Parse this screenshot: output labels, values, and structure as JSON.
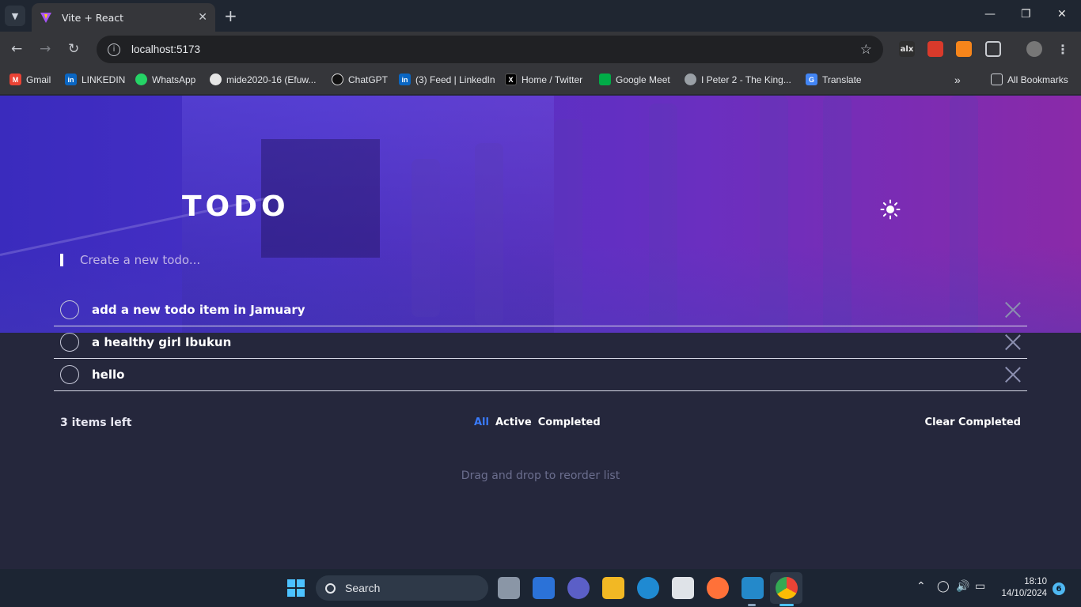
{
  "browser": {
    "tab_title": "Vite + React",
    "url": "localhost:5173",
    "bookmarks": [
      {
        "label": "Gmail",
        "icon": "gmail-icon",
        "color": "#ea4335"
      },
      {
        "label": "LINKEDIN",
        "icon": "linkedin-icon",
        "color": "#0a66c2"
      },
      {
        "label": "WhatsApp",
        "icon": "whatsapp-icon",
        "color": "#25d366"
      },
      {
        "label": "mide2020-16 (Efuw...",
        "icon": "github-icon",
        "color": "#e6e6e6"
      },
      {
        "label": "ChatGPT",
        "icon": "chatgpt-icon",
        "color": "#ffffff"
      },
      {
        "label": "(3) Feed | LinkedIn",
        "icon": "linkedin-icon",
        "color": "#0a66c2"
      },
      {
        "label": "Home / Twitter",
        "icon": "x-twitter-icon",
        "color": "#000000"
      },
      {
        "label": "Google Meet",
        "icon": "google-meet-icon",
        "color": "#00ac47"
      },
      {
        "label": "I Peter 2 - The King...",
        "icon": "globe-icon",
        "color": "#9aa0a6"
      },
      {
        "label": "Translate",
        "icon": "google-translate-icon",
        "color": "#4285f4"
      }
    ],
    "all_bookmarks_label": "All Bookmarks",
    "extensions": [
      {
        "name": "alx-extension-icon",
        "text": "alx"
      },
      {
        "name": "red-extension-icon",
        "text": ""
      },
      {
        "name": "metamask-icon",
        "text": ""
      }
    ]
  },
  "app": {
    "title": "TODO",
    "theme_icon": "sun-icon",
    "create_placeholder": "Create a new todo...",
    "todos": [
      {
        "text": "add a new todo item in Jamuary",
        "completed": false
      },
      {
        "text": "a healthy girl Ibukun",
        "completed": false
      },
      {
        "text": "hello",
        "completed": false
      }
    ],
    "items_left": "3 items left",
    "filters": {
      "all": "All",
      "active": "Active",
      "completed": "Completed"
    },
    "active_filter": "all",
    "clear_label": "Clear Completed",
    "hint": "Drag and drop to reorder list",
    "colors": {
      "accent": "#3a7bfd",
      "background": "#25273c",
      "hero_start": "#3a2bbd",
      "hero_end": "#8a2aa8"
    }
  },
  "taskbar": {
    "search_label": "Search",
    "time": "18:10",
    "date": "14/10/2024",
    "notification_count": "6"
  }
}
